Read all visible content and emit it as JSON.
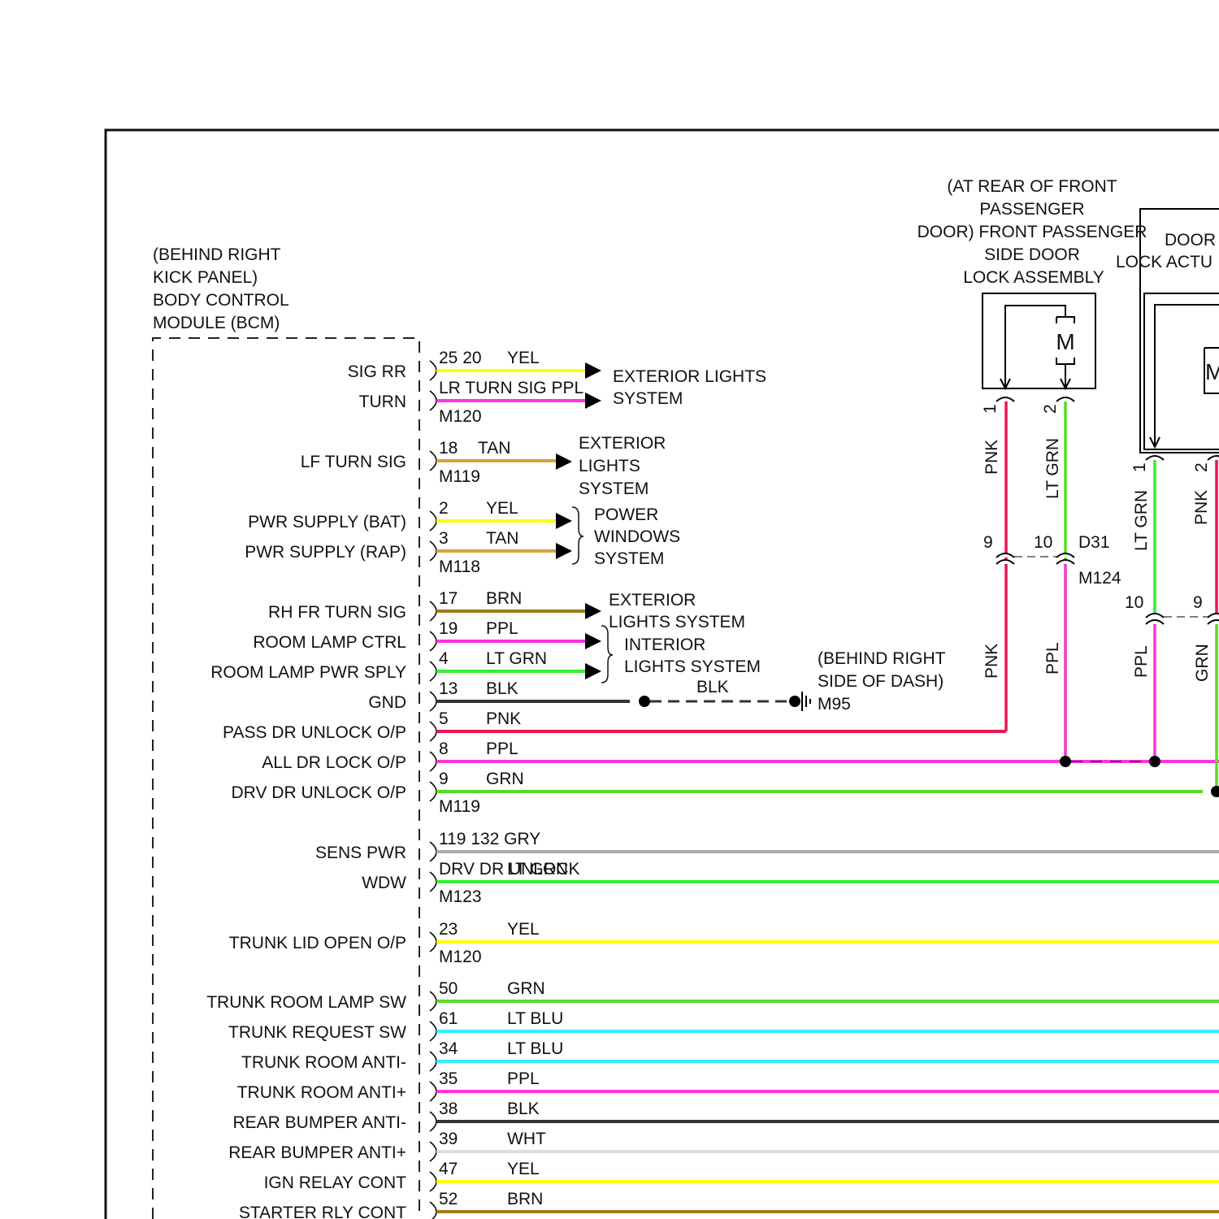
{
  "bcm": {
    "title": [
      "(BEHIND RIGHT",
      "KICK PANEL)",
      "BODY CONTROL",
      "MODULE (BCM)"
    ]
  },
  "pins": [
    {
      "label": "SIG RR",
      "pin": "25 20",
      "color_name": "YEL",
      "color": "#ffff00"
    },
    {
      "label": "TURN",
      "pin": "LR TURN SIG PPL",
      "color_name": "",
      "color": "#ff33dd",
      "connector": "M120"
    },
    {
      "label": "LF TURN SIG",
      "pin": "18",
      "color_name": "TAN",
      "color": "#d8a33c",
      "connector": "M119"
    },
    {
      "label": "PWR SUPPLY (BAT)",
      "pin": "2",
      "color_name": "YEL",
      "color": "#ffff00"
    },
    {
      "label": "PWR SUPPLY (RAP)",
      "pin": "3",
      "color_name": "TAN",
      "color": "#d8a33c",
      "connector": "M118"
    },
    {
      "label": "RH FR TURN SIG",
      "pin": "17",
      "color_name": "BRN",
      "color": "#a07a1a"
    },
    {
      "label": "ROOM LAMP CTRL",
      "pin": "19",
      "color_name": "PPL",
      "color": "#ff33dd"
    },
    {
      "label": "ROOM LAMP PWR SPLY",
      "pin": "4",
      "color_name": "LT GRN",
      "color": "#33ee33"
    },
    {
      "label": "GND",
      "pin": "13",
      "color_name": "BLK",
      "color": "#333333"
    },
    {
      "label": "PASS DR UNLOCK O/P",
      "pin": "5",
      "color_name": "PNK",
      "color": "#e8174f"
    },
    {
      "label": "ALL DR LOCK O/P",
      "pin": "8",
      "color_name": "PPL",
      "color": "#ff33dd"
    },
    {
      "label": "DRV DR UNLOCK O/P",
      "pin": "9",
      "color_name": "GRN",
      "color": "#55dd22",
      "connector": "M119"
    },
    {
      "label": "SENS PWR",
      "pin": "119 132 GRY",
      "color_name": "",
      "color": "#aaaaaa"
    },
    {
      "label": "WDW",
      "pin": "DRV DR UNLOCK",
      "color_name": "LT GRN",
      "color": "#33ee33",
      "connector": "M123"
    },
    {
      "label": "TRUNK LID OPEN O/P",
      "pin": "23",
      "color_name": "YEL",
      "color": "#ffff00",
      "connector": "M120"
    },
    {
      "label": "TRUNK ROOM LAMP SW",
      "pin": "50",
      "color_name": "GRN",
      "color": "#55dd22"
    },
    {
      "label": "TRUNK REQUEST SW",
      "pin": "61",
      "color_name": "LT BLU",
      "color": "#33eeff"
    },
    {
      "label": "TRUNK ROOM ANTI-",
      "pin": "34",
      "color_name": "LT BLU",
      "color": "#33eeff"
    },
    {
      "label": "TRUNK ROOM ANTI+",
      "pin": "35",
      "color_name": "PPL",
      "color": "#ff33dd"
    },
    {
      "label": "REAR BUMPER ANTI-",
      "pin": "38",
      "color_name": "BLK",
      "color": "#333333"
    },
    {
      "label": "REAR BUMPER ANTI+",
      "pin": "39",
      "color_name": "WHT",
      "color": "#dddddd"
    },
    {
      "label": "IGN RELAY CONT",
      "pin": "47",
      "color_name": "YEL",
      "color": "#ffff00"
    },
    {
      "label": "STARTER RLY CONT",
      "pin": "52",
      "color_name": "BRN",
      "color": "#a07a1a"
    }
  ],
  "destinations": {
    "ext1": [
      "EXTERIOR LIGHTS",
      "SYSTEM"
    ],
    "ext2": [
      "EXTERIOR",
      "LIGHTS",
      "SYSTEM"
    ],
    "pw": [
      "POWER",
      "WINDOWS",
      "SYSTEM"
    ],
    "ext3": [
      "EXTERIOR",
      "LIGHTS SYSTEM"
    ],
    "interior": [
      "INTERIOR",
      "LIGHTS SYSTEM"
    ]
  },
  "ground": {
    "color_name": "BLK",
    "location": [
      "(BEHIND RIGHT",
      "SIDE OF DASH)"
    ],
    "id": "M95"
  },
  "front_pass_lock": {
    "title": [
      "(AT REAR OF FRONT",
      "PASSENGER",
      "DOOR) FRONT PASSENGER",
      "SIDE DOOR",
      "LOCK ASSEMBLY"
    ],
    "motor": "M",
    "pin1": "1",
    "pin2": "2",
    "wire1": "PNK",
    "wire2": "LT GRN",
    "c_pin9": "9",
    "c_pin10": "10",
    "c_d31": "D31",
    "c_m124": "M124",
    "wire1_lower": "PNK",
    "wire2_lower": "PPL"
  },
  "door_lock_actuator": {
    "title": [
      "DOOR",
      "LOCK ACTU"
    ],
    "motor": "M",
    "pin1": "1",
    "pin2": "2",
    "wire1": "LT GRN",
    "wire2": "PNK",
    "c_pin10": "10",
    "c_pin9": "9",
    "wire1_lower": "PPL",
    "wire2_lower": "GRN"
  }
}
